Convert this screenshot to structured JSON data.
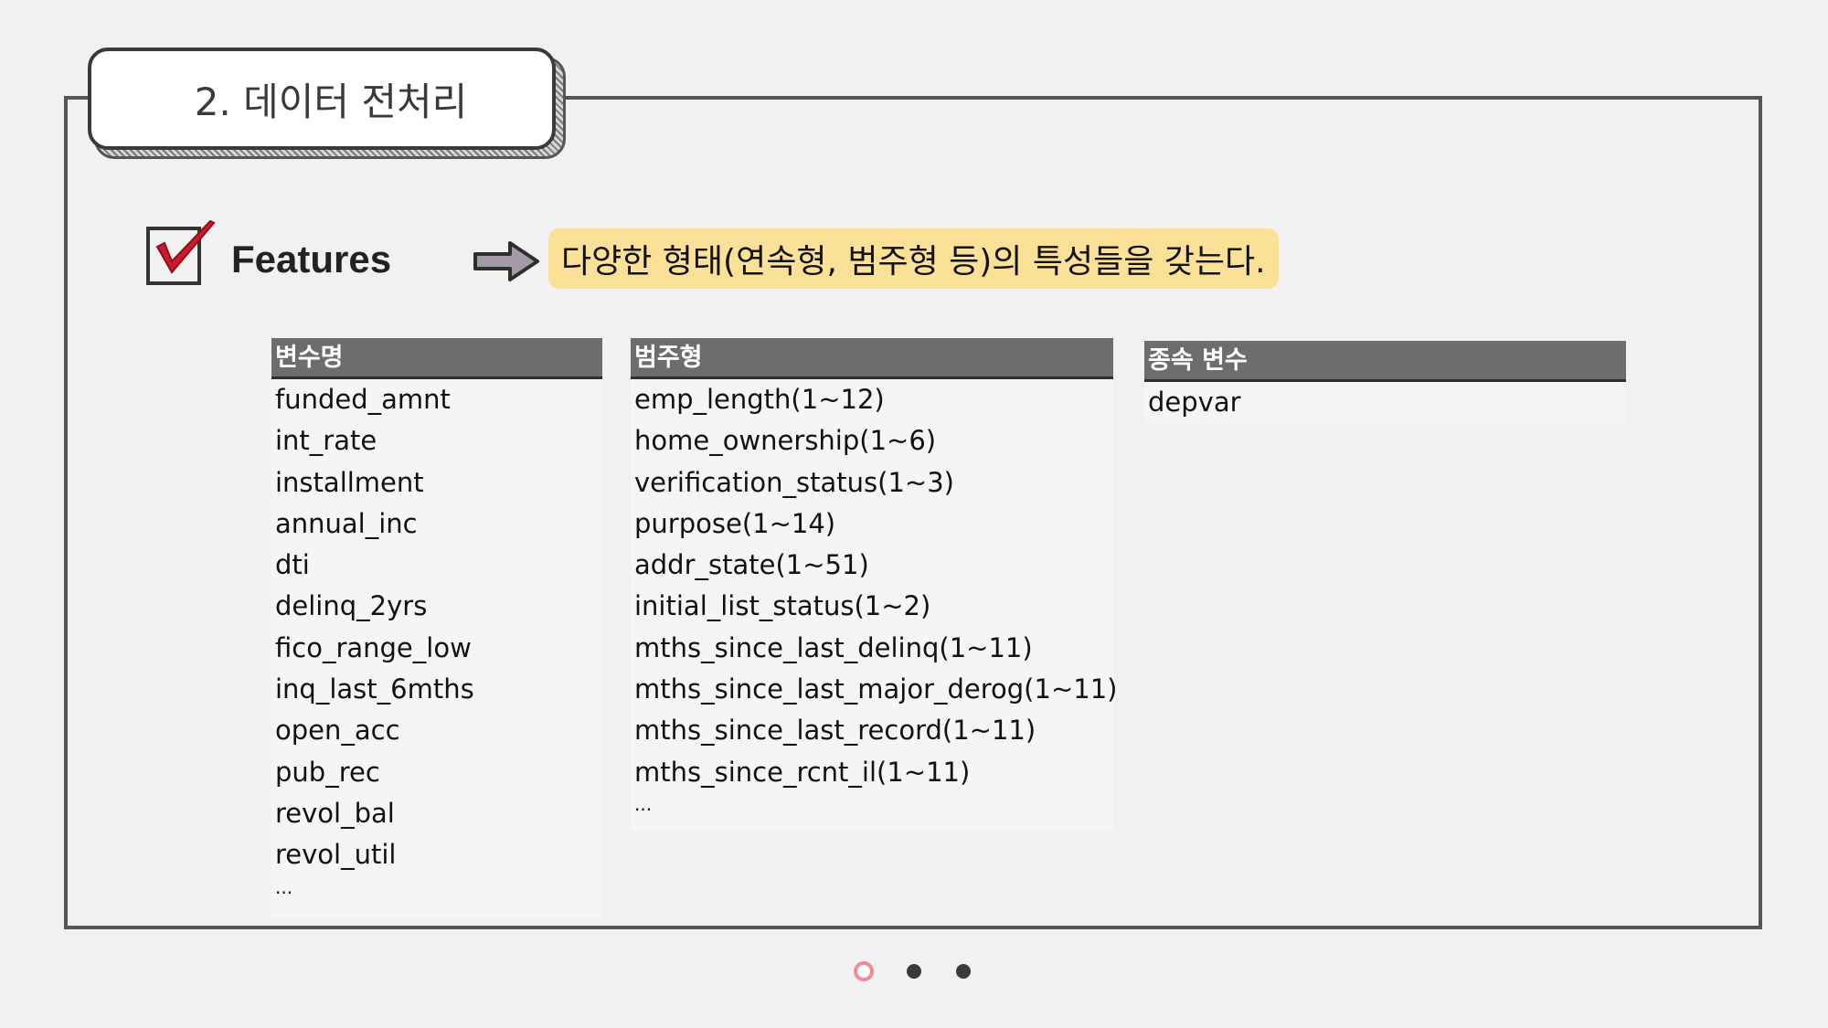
{
  "slide": {
    "title": "2. 데이터 전처리",
    "features_label": "Features",
    "description": "다양한 형태(연속형, 범주형 등)의 특성들을 갖는다."
  },
  "tables": {
    "numeric": {
      "header": "변수명",
      "rows": [
        "funded_amnt",
        "int_rate",
        "installment",
        "annual_inc",
        "dti",
        "delinq_2yrs",
        "fico_range_low",
        "inq_last_6mths",
        "open_acc",
        "pub_rec",
        "revol_bal",
        "revol_util"
      ],
      "more": "..."
    },
    "categorical": {
      "header": "범주형",
      "rows": [
        "emp_length(1~12)",
        "home_ownership(1~6)",
        "verification_status(1~3)",
        "purpose(1~14)",
        "addr_state(1~51)",
        "initial_list_status(1~2)",
        "mths_since_last_delinq(1~11)",
        "mths_since_last_major_derog(1~11)",
        "mths_since_last_record(1~11)",
        "mths_since_rcnt_il(1~11)"
      ],
      "more": "..."
    },
    "dependent": {
      "header": "종속 변수",
      "rows": [
        "depvar"
      ]
    }
  },
  "pagination": {
    "count": 3,
    "active_index": 0
  },
  "colors": {
    "highlight": "#fbe197",
    "table_header": "#6d6d6d",
    "check_mark": "#d1182a",
    "active_dot": "#f08b96"
  },
  "icons": [
    "checkbox-checked-icon",
    "right-arrow-icon"
  ]
}
